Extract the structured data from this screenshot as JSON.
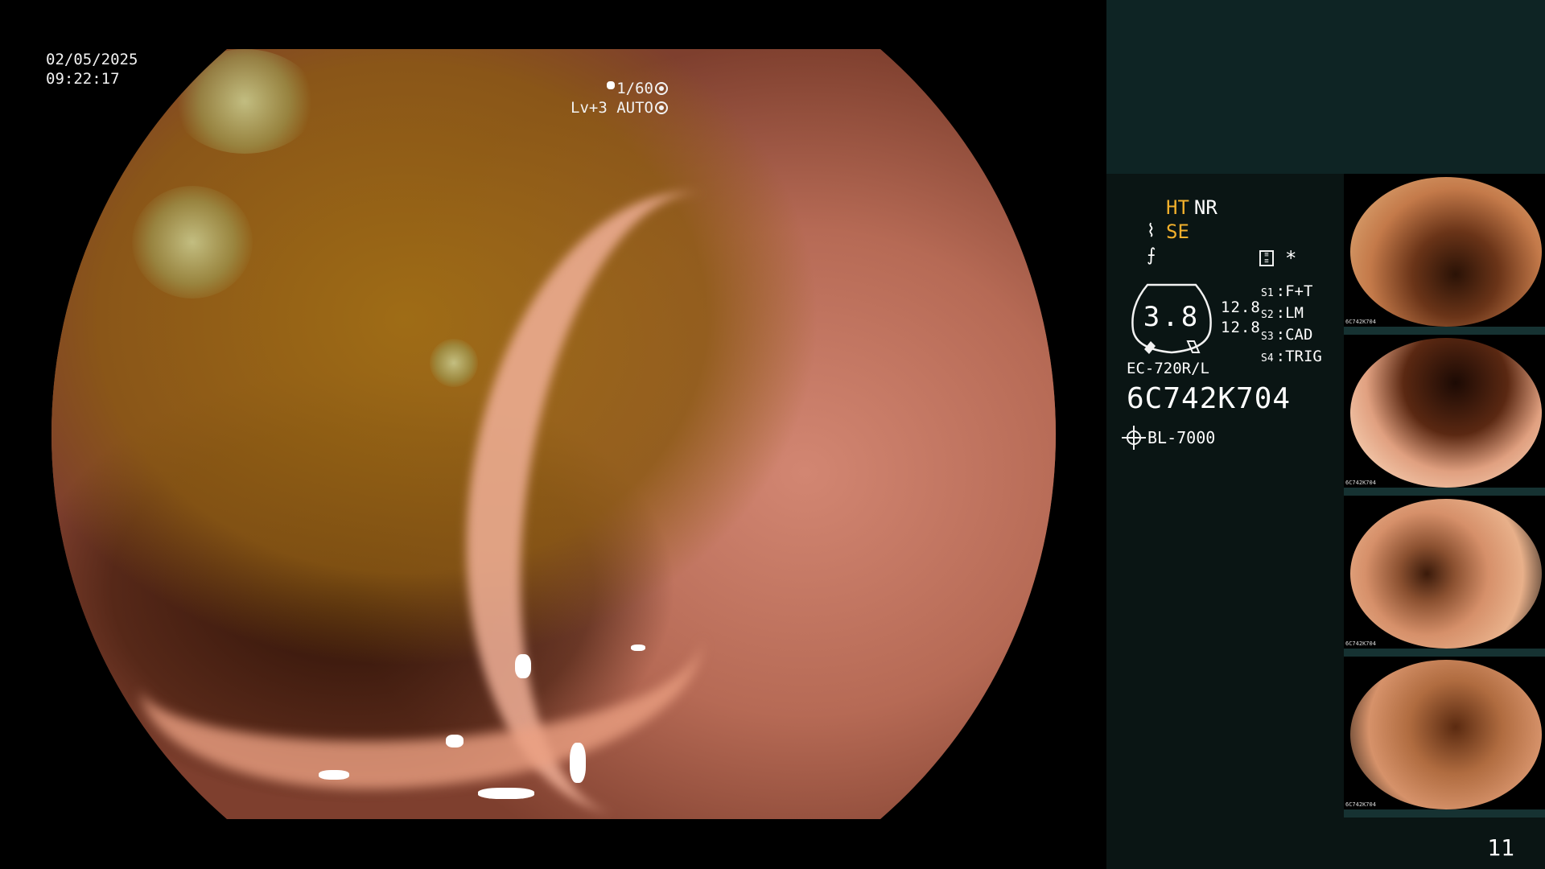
{
  "main_view": {
    "date": "02/05/2025",
    "time": "09:22:17",
    "shutter": "1/60",
    "iris": "Lv+3 AUTO"
  },
  "panel": {
    "mode_ht": "HT",
    "mode_nr": "NR",
    "mode_se": "SE",
    "switch_mark": "*",
    "zoom_value": "3.8",
    "mag_values": [
      "12.8",
      "12.8"
    ],
    "slots": [
      {
        "key": "S1",
        "value": "F+T"
      },
      {
        "key": "S2",
        "value": "LM"
      },
      {
        "key": "S3",
        "value": "CAD"
      },
      {
        "key": "S4",
        "value": "TRIG"
      }
    ],
    "scope_model": "EC-720R/L",
    "scope_serial": "6C742K704",
    "light_source": "BL-7000"
  },
  "thumbnails": [
    {
      "label": "6C742K704"
    },
    {
      "label": "6C742K704"
    },
    {
      "label": "6C742K704"
    },
    {
      "label": "6C742K704"
    }
  ],
  "page_number": "11",
  "colors": {
    "highlight": "#f2b02c",
    "panel_bg": "#0a1514",
    "panel_top": "#0e2424"
  }
}
